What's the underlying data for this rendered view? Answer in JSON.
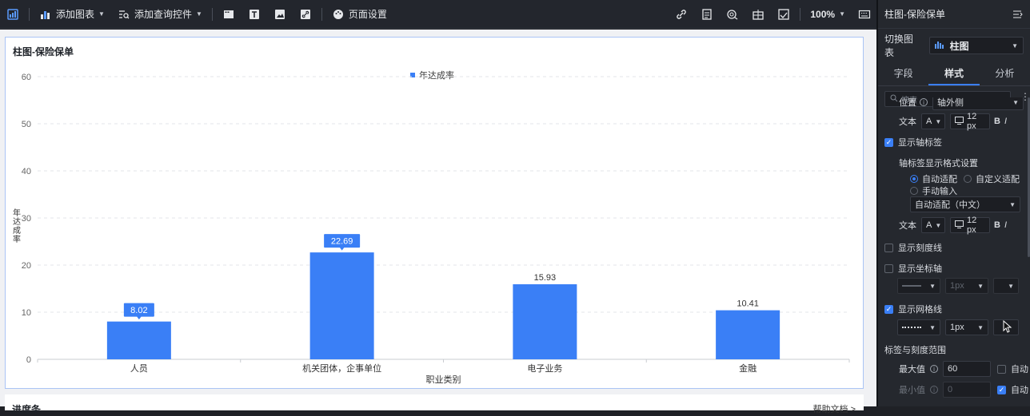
{
  "toolbar": {
    "add_chart": "添加图表",
    "add_query_control": "添加查询控件",
    "page_settings": "页面设置",
    "zoom": "100%"
  },
  "card": {
    "title": "柱图-保险保单"
  },
  "chart_data": {
    "type": "bar",
    "categories": [
      "人员",
      "机关团体，企事单位",
      "电子业务",
      "金融"
    ],
    "series": [
      {
        "name": "年达成率",
        "values": [
          8.02,
          22.69,
          15.93,
          10.41
        ]
      }
    ],
    "data_labels": [
      "8.02",
      "22.69",
      "15.93",
      "10.41"
    ],
    "highlighted": [
      true,
      true,
      false,
      false
    ],
    "xlabel": "职业类别",
    "ylabel": "年达成率",
    "ylim": [
      0,
      60
    ],
    "yticks": [
      "0",
      "10",
      "20",
      "30",
      "40",
      "50",
      "60"
    ],
    "grid": true,
    "legend": "top-center",
    "color": "#3a7ff6"
  },
  "card2": {
    "title": "进度条",
    "help": "帮助文档 >"
  },
  "panel": {
    "title": "柱图-保险保单",
    "switch_label": "切换图表",
    "switch_value": "柱图",
    "tabs": [
      "字段",
      "样式",
      "分析"
    ],
    "search_placeholder": "搜索",
    "position_label": "位置",
    "position_value": "轴外侧",
    "text_label": "文本",
    "font_letter": "A",
    "font_size": "12 px",
    "bold": "B",
    "italic": "I",
    "show_axis_label": "显示轴标签",
    "axis_label_format": "轴标签显示格式设置",
    "auto_fit": "自动适配",
    "custom_fit": "自定义适配",
    "manual_input": "手动输入",
    "auto_fit_select": "自动适配（中文）",
    "show_ticks": "显示刻度线",
    "show_axis": "显示坐标轴",
    "line_width_1": "1px",
    "show_gridlines": "显示网格线",
    "line_width_2": "1px",
    "range_title": "标签与刻度范围",
    "max_label": "最大值",
    "max_value": "60",
    "auto_label": "自动",
    "min_label": "最小值",
    "min_value": "0",
    "auto_label_2": "自动"
  }
}
